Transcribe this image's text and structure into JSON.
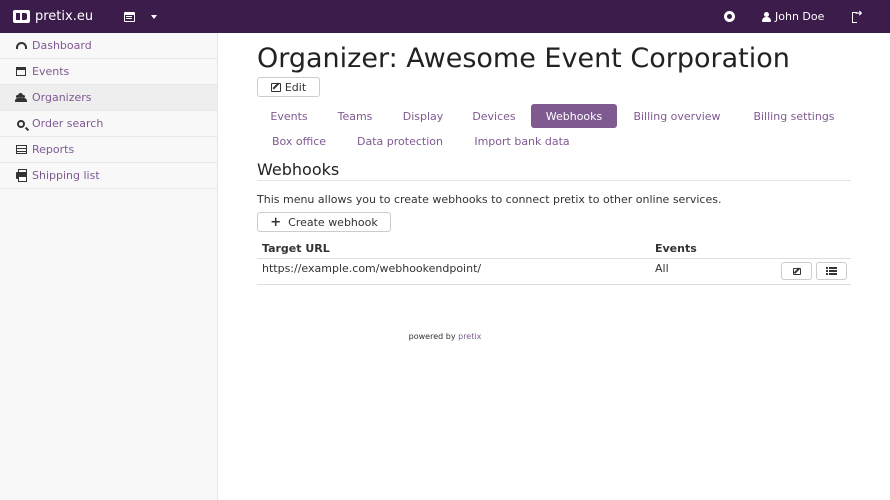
{
  "navbar": {
    "brand": "pretix.eu",
    "user_name": "John Doe"
  },
  "sidebar": {
    "items": [
      {
        "label": "Dashboard",
        "icon": "dashboard-icon"
      },
      {
        "label": "Events",
        "icon": "calendar-icon"
      },
      {
        "label": "Organizers",
        "icon": "users-icon",
        "active": true
      },
      {
        "label": "Order search",
        "icon": "search-icon"
      },
      {
        "label": "Reports",
        "icon": "table-icon"
      },
      {
        "label": "Shipping list",
        "icon": "print-icon"
      }
    ]
  },
  "main": {
    "title": "Organizer: Awesome Event Corporation",
    "edit_label": "Edit",
    "tabs": [
      {
        "label": "Events"
      },
      {
        "label": "Teams"
      },
      {
        "label": "Display"
      },
      {
        "label": "Devices"
      },
      {
        "label": "Webhooks",
        "active": true
      },
      {
        "label": "Billing overview"
      },
      {
        "label": "Billing settings"
      },
      {
        "label": "Box office"
      },
      {
        "label": "Data protection"
      },
      {
        "label": "Import bank data"
      }
    ],
    "section_title": "Webhooks",
    "description": "This menu allows you to create webhooks to connect pretix to other online services.",
    "create_label": "Create webhook",
    "table": {
      "headers": [
        "Target URL",
        "Events"
      ],
      "rows": [
        {
          "target_url": "https://example.com/webhookendpoint/",
          "events": "All"
        }
      ]
    }
  },
  "footer": {
    "prefix": "powered by",
    "link": "pretix"
  },
  "colors": {
    "navbar": "#3b1c4a",
    "accent": "#7f5a91"
  }
}
